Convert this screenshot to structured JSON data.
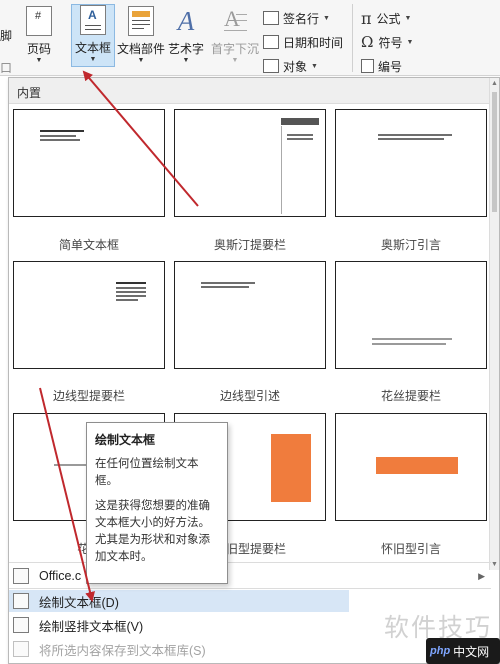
{
  "ribbon": {
    "footer_label": "脚",
    "page_number_label": "页码",
    "textbox_label": "文本框",
    "quick_parts_label": "文档部件",
    "wordart_label": "艺术字",
    "dropcap_label": "首字下沉",
    "signature_label": "签名行",
    "datetime_label": "日期和时间",
    "object_label": "对象",
    "equation_label": "公式",
    "symbol_label": "符号",
    "number_label": "编号",
    "left_edge_text": "口"
  },
  "gallery": {
    "section_title": "内置",
    "items": [
      {
        "label": "简单文本框"
      },
      {
        "label": "奥斯汀提要栏"
      },
      {
        "label": "奥斯汀引言"
      },
      {
        "label": "边线型提要栏"
      },
      {
        "label": "边线型引述"
      },
      {
        "label": "花丝提要栏"
      },
      {
        "label": "花丝"
      },
      {
        "label": "怀旧型提要栏"
      },
      {
        "label": "怀旧型引言"
      }
    ],
    "accent_color": "#f07c3d"
  },
  "menu": {
    "office_more": "Office.c",
    "draw_textbox": "绘制文本框(D)",
    "draw_vertical_textbox": "绘制竖排文本框(V)",
    "save_selection": "将所选内容保存到文本框库(S)"
  },
  "tooltip": {
    "title": "绘制文本框",
    "line1": "在任何位置绘制文本框。",
    "line2": "这是获得您想要的准确文本框大小的好方法。尤其是为形状和对象添加文本时。"
  },
  "watermark": {
    "text": "软件技巧",
    "badge_php": "php",
    "badge_site": "中文网"
  },
  "colors": {
    "highlight": "#d7e6f6",
    "arrow": "#c0282d",
    "ribbon_active": "#cde4f7"
  }
}
